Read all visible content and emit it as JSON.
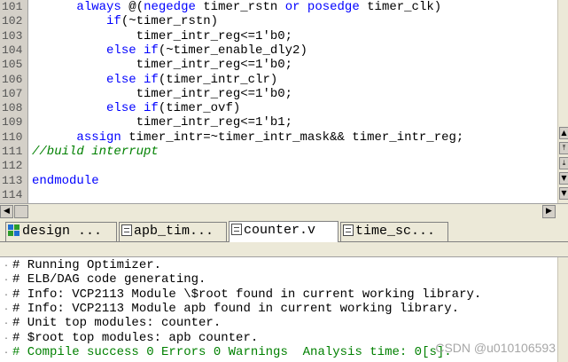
{
  "editor": {
    "lines": [
      {
        "num": "101",
        "parts": [
          {
            "t": "      "
          },
          {
            "t": "always",
            "k": "kw"
          },
          {
            "t": " @("
          },
          {
            "t": "negedge",
            "k": "kw"
          },
          {
            "t": " timer_rstn "
          },
          {
            "t": "or",
            "k": "kw"
          },
          {
            "t": " "
          },
          {
            "t": "posedge",
            "k": "kw"
          },
          {
            "t": " timer_clk)"
          }
        ]
      },
      {
        "num": "102",
        "parts": [
          {
            "t": "          "
          },
          {
            "t": "if",
            "k": "kw"
          },
          {
            "t": "(~timer_rstn)"
          }
        ]
      },
      {
        "num": "103",
        "parts": [
          {
            "t": "              timer_intr_reg<=1'b0;"
          }
        ]
      },
      {
        "num": "104",
        "parts": [
          {
            "t": "          "
          },
          {
            "t": "else if",
            "k": "kw"
          },
          {
            "t": "(~timer_enable_dly2)"
          }
        ]
      },
      {
        "num": "105",
        "parts": [
          {
            "t": "              timer_intr_reg<=1'b0;"
          }
        ]
      },
      {
        "num": "106",
        "parts": [
          {
            "t": "          "
          },
          {
            "t": "else if",
            "k": "kw"
          },
          {
            "t": "(timer_intr_clr)"
          }
        ]
      },
      {
        "num": "107",
        "parts": [
          {
            "t": "              timer_intr_reg<=1'b0;"
          }
        ]
      },
      {
        "num": "108",
        "parts": [
          {
            "t": "          "
          },
          {
            "t": "else if",
            "k": "kw"
          },
          {
            "t": "(timer_ovf)"
          }
        ]
      },
      {
        "num": "109",
        "parts": [
          {
            "t": "              timer_intr_reg<=1'b1;"
          }
        ]
      },
      {
        "num": "110",
        "parts": [
          {
            "t": "      "
          },
          {
            "t": "assign",
            "k": "kw"
          },
          {
            "t": " timer_intr=~timer_intr_mask&& timer_intr_reg;"
          }
        ]
      },
      {
        "num": "111",
        "parts": [
          {
            "t": "//build interrupt",
            "k": "cm"
          }
        ]
      },
      {
        "num": "112",
        "parts": [
          {
            "t": ""
          }
        ]
      },
      {
        "num": "113",
        "parts": [
          {
            "t": "endmodule",
            "k": "kw"
          }
        ]
      },
      {
        "num": "114",
        "parts": [
          {
            "t": ""
          }
        ]
      }
    ]
  },
  "scrollbar_glyphs": {
    "up": "▲",
    "down": "▼",
    "left": "◀",
    "right": "▶",
    "top": "⤒",
    "bottom": "⤓"
  },
  "tabs": [
    {
      "label": "design ...",
      "icon": "design-icon",
      "active": false
    },
    {
      "label": "apb_tim...",
      "icon": "file-icon",
      "active": false
    },
    {
      "label": "counter.v",
      "icon": "file-icon",
      "active": true
    },
    {
      "label": "time_sc...",
      "icon": "file-icon",
      "active": false
    }
  ],
  "transcript": {
    "lines": [
      {
        "text": "# Running Optimizer.",
        "status": "normal"
      },
      {
        "text": "# ELB/DAG code generating.",
        "status": "normal"
      },
      {
        "text": "# Info: VCP2113 Module \\$root found in current working library.",
        "status": "normal"
      },
      {
        "text": "# Info: VCP2113 Module apb found in current working library.",
        "status": "normal"
      },
      {
        "text": "# Unit top modules: counter.",
        "status": "normal"
      },
      {
        "text": "# $root top modules: apb counter.",
        "status": "normal"
      },
      {
        "text": "# Compile success 0 Errors 0 Warnings  Analysis time: 0[s].",
        "status": "success"
      }
    ]
  },
  "watermark": "CSDN @u010106593",
  "colors": {
    "keyword": "#0000ff",
    "comment": "#008000",
    "success": "#008000",
    "panel": "#ece9d8"
  }
}
